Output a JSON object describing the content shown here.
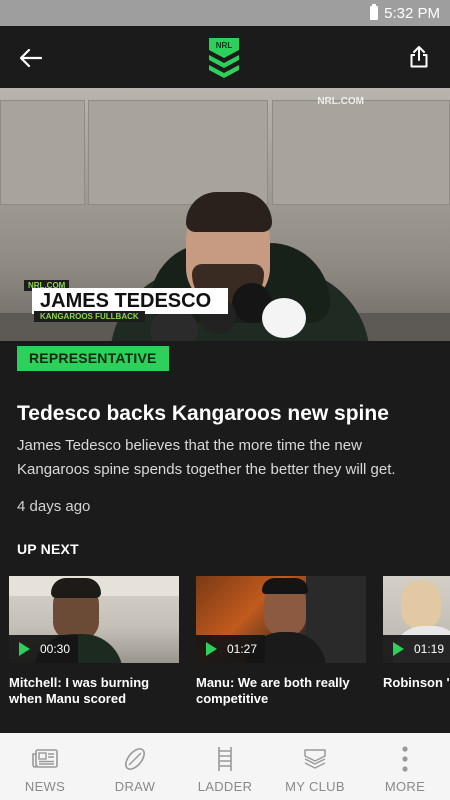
{
  "status_bar": {
    "time": "5:32 PM"
  },
  "hero": {
    "watermark": "NRL.COM",
    "lower_third": {
      "tag": "NRL.COM",
      "name": "JAMES TEDESCO",
      "role": "KANGAROOS FULLBACK"
    }
  },
  "article": {
    "category": "REPRESENTATIVE",
    "title": "Tedesco backs Kangaroos new spine",
    "summary": "James Tedesco believes that the more time the new Kangaroos spine spends together the better they will get.",
    "time_ago": "4 days ago"
  },
  "up_next": {
    "heading": "UP NEXT",
    "videos": [
      {
        "duration": "00:30",
        "title": "Mitchell: I was burning when Manu scored"
      },
      {
        "duration": "01:27",
        "title": "Manu: We are both really competitive"
      },
      {
        "duration": "01:19",
        "title": "Robinson 'o with debut a"
      }
    ]
  },
  "bottom_nav": {
    "items": [
      {
        "label": "NEWS",
        "icon": "newspaper-icon"
      },
      {
        "label": "DRAW",
        "icon": "football-icon"
      },
      {
        "label": "LADDER",
        "icon": "ladder-icon"
      },
      {
        "label": "MY CLUB",
        "icon": "club-icon"
      },
      {
        "label": "MORE",
        "icon": "more-vertical-icon"
      }
    ]
  },
  "colors": {
    "accent": "#2cd05a",
    "background": "#1b1b1b",
    "status_bar": "#9e9e9e",
    "nav_bg": "#f5f5f5"
  }
}
